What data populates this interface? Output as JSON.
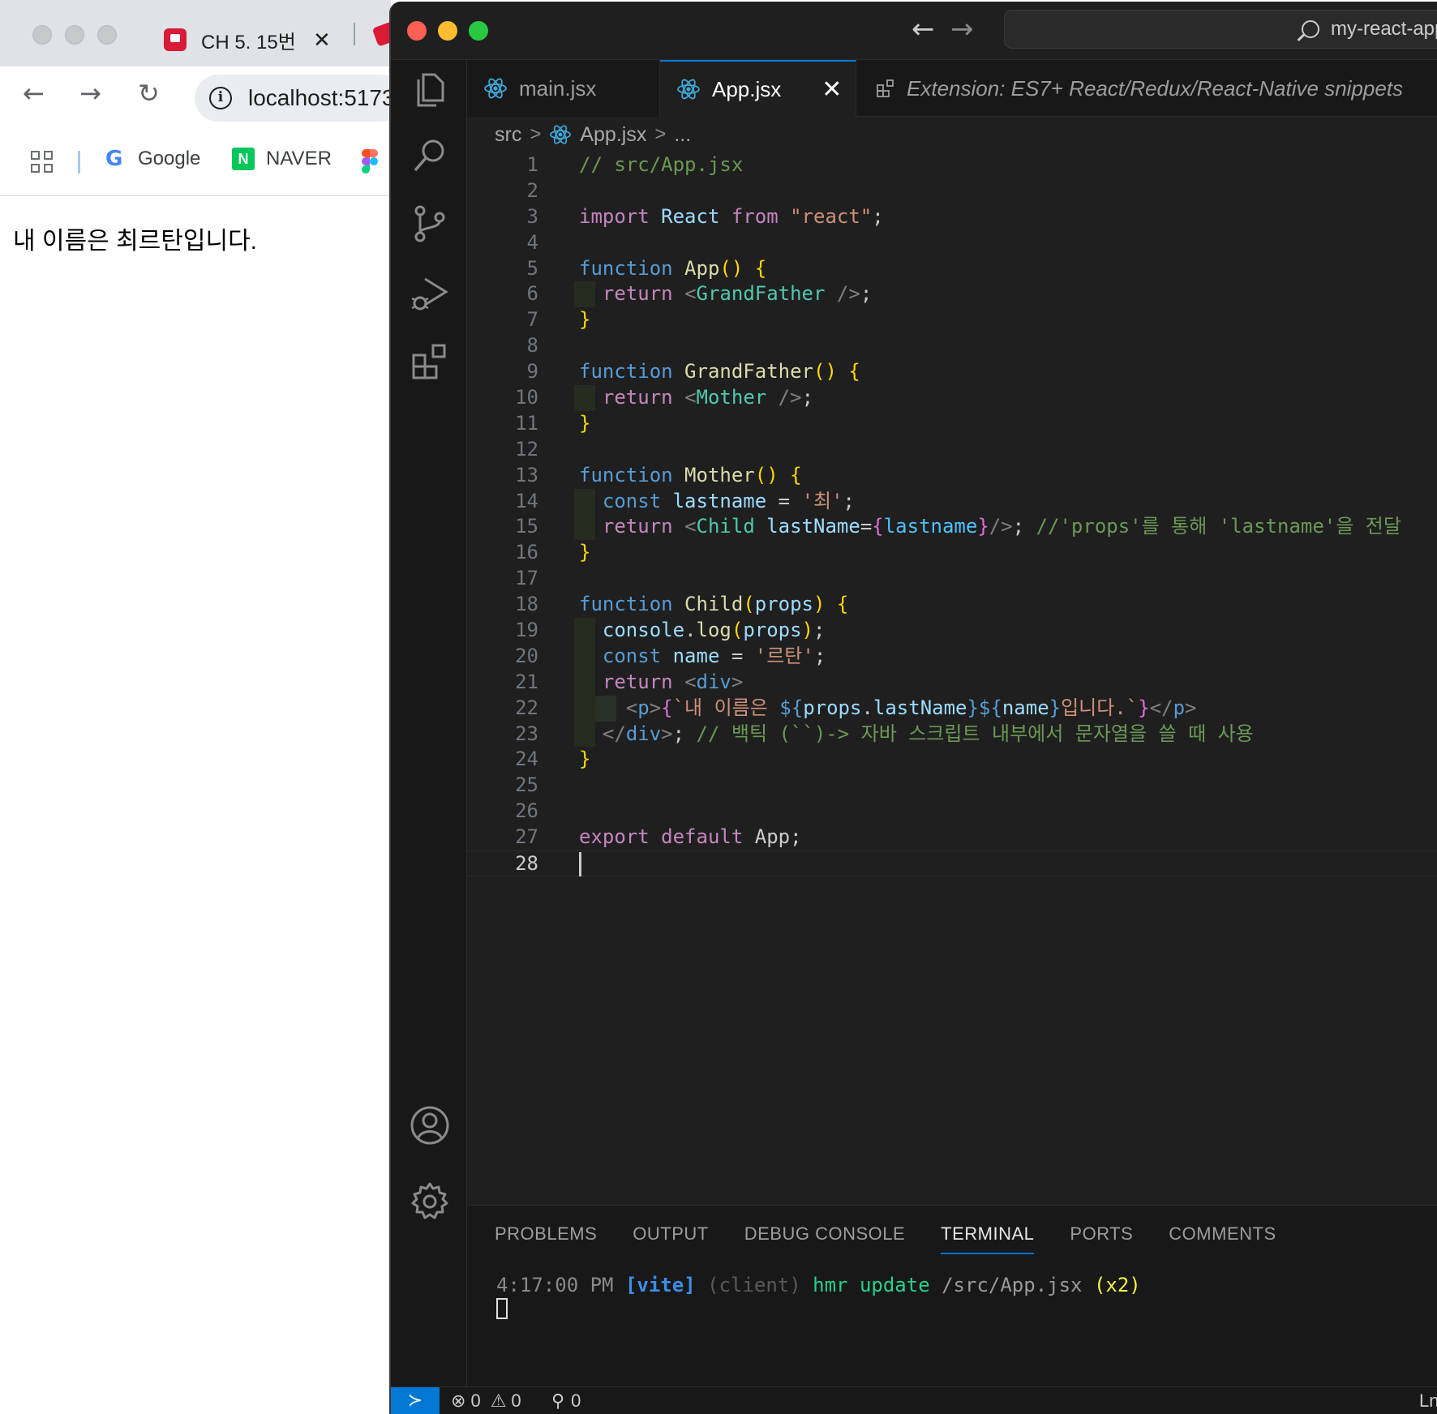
{
  "browser": {
    "tab_title": "CH 5. 15번",
    "tab_close": "✕",
    "url": "localhost:5173",
    "bookmarks": [
      {
        "label": "Google",
        "icon": "google-icon"
      },
      {
        "label": "NAVER",
        "icon": "naver-icon"
      },
      {
        "label": "",
        "icon": "figma-icon"
      }
    ],
    "page_text": "내 이름은 최르탄입니다."
  },
  "vscode": {
    "command_center": "my-react-app",
    "tabs": [
      {
        "label": "main.jsx",
        "icon": "react-icon",
        "active": false
      },
      {
        "label": "App.jsx",
        "icon": "react-icon",
        "active": true
      },
      {
        "label": "Extension: ES7+ React/Redux/React-Native snippets",
        "icon": "extensions-icon",
        "active": false
      }
    ],
    "tab_close": "✕",
    "breadcrumb": [
      "src",
      "App.jsx",
      "..."
    ],
    "current_line": 28,
    "code_lines": [
      "// src/App.jsx",
      "",
      "import React from \"react\";",
      "",
      "function App() {",
      "  return <GrandFather />;",
      "}",
      "",
      "function GrandFather() {",
      "  return <Mother />;",
      "}",
      "",
      "function Mother() {",
      "  const lastname = '최';",
      "  return <Child lastName={lastname}/>; //'props'를 통해 'lastname'을 전달",
      "}",
      "",
      "function Child(props) {",
      "  console.log(props);",
      "  const name = '르탄';",
      "  return <div>",
      "    <p>{`내 이름은 ${props.lastName}${name}입니다.`}</p>",
      "  </div>; // 백틱 (``)-> 자바 스크립트 내부에서 문자열을 쓸 때 사용",
      "}",
      "",
      "",
      "export default App;",
      ""
    ],
    "panel_tabs": [
      "PROBLEMS",
      "OUTPUT",
      "DEBUG CONSOLE",
      "TERMINAL",
      "PORTS",
      "COMMENTS"
    ],
    "active_panel_tab": "TERMINAL",
    "terminal": {
      "time": "4:17:00 PM",
      "tag": "[vite]",
      "scope": "(client)",
      "message": "hmr update",
      "path": "/src/App.jsx",
      "count": "(x2)"
    },
    "status": {
      "errors": "0",
      "warnings": "0",
      "ports": "0",
      "right": "Ln"
    }
  }
}
